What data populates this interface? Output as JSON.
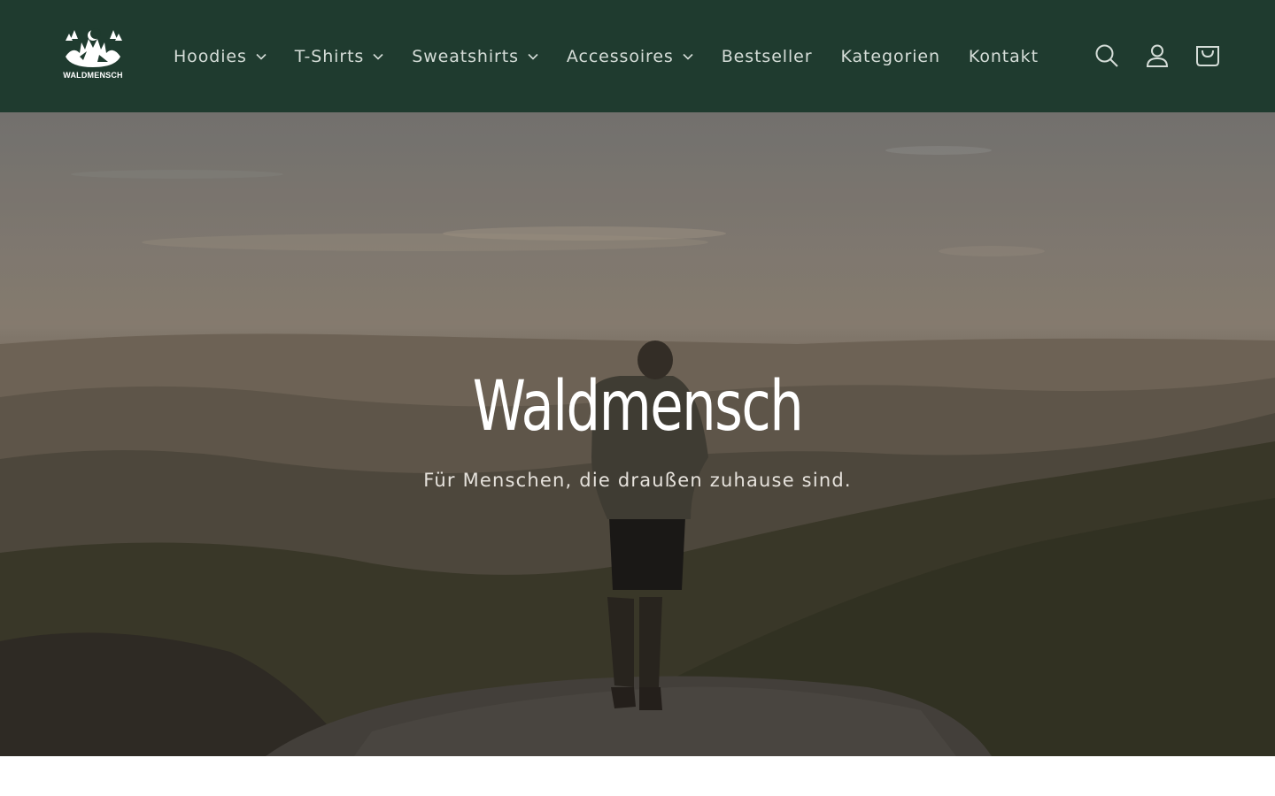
{
  "brand": {
    "logo_text": "WALDMENSCH",
    "logo_icon": "forest-moon-logo"
  },
  "nav": {
    "items": [
      {
        "label": "Hoodies",
        "has_dropdown": true
      },
      {
        "label": "T-Shirts",
        "has_dropdown": true
      },
      {
        "label": "Sweatshirts",
        "has_dropdown": true
      },
      {
        "label": "Accessoires",
        "has_dropdown": true
      },
      {
        "label": "Bestseller",
        "has_dropdown": false
      },
      {
        "label": "Kategorien",
        "has_dropdown": false
      },
      {
        "label": "Kontakt",
        "has_dropdown": false
      }
    ]
  },
  "header_icons": [
    "search-icon",
    "account-icon",
    "cart-icon"
  ],
  "hero": {
    "title": "Waldmensch",
    "subtitle": "Für Menschen, die draußen zuhause sind."
  },
  "colors": {
    "header_bg": "#1f3b2f",
    "nav_text": "#d5ddd8",
    "hero_text": "#ffffff"
  }
}
